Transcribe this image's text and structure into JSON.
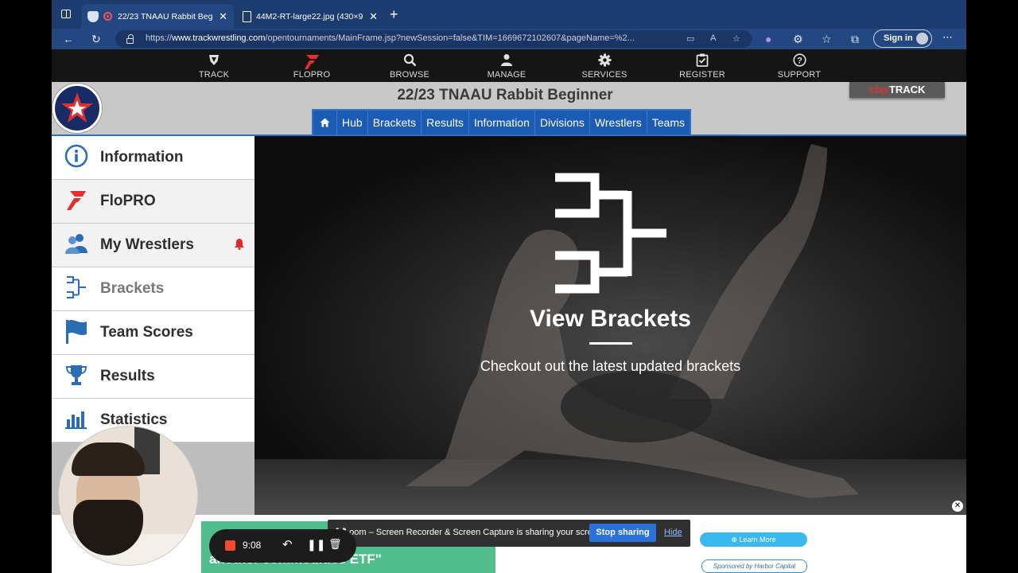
{
  "browser": {
    "tabs": [
      {
        "title": "22/23 TNAAU Rabbit Beg",
        "active": true
      },
      {
        "title": "44M2-RT-large22.jpg (430×9",
        "active": false
      }
    ],
    "url_prefix": "https://",
    "url_domain": "www.trackwrestling.com",
    "url_path": "/opentournaments/MainFrame.jsp?newSession=false&TIM=1669672102607&pageName=%2...",
    "signin_label": "Sign in"
  },
  "site_nav": {
    "items": [
      {
        "label": "TRACK",
        "icon": "track-shield-icon"
      },
      {
        "label": "FLOPRO",
        "icon": "flo-icon"
      },
      {
        "label": "BROWSE",
        "icon": "search-icon"
      },
      {
        "label": "MANAGE",
        "icon": "user-icon"
      },
      {
        "label": "SERVICES",
        "icon": "gear-icon"
      },
      {
        "label": "REGISTER",
        "icon": "clipboard-icon"
      },
      {
        "label": "SUPPORT",
        "icon": "help-icon"
      }
    ]
  },
  "event": {
    "title": "22/23 TNAAU Rabbit Beginner",
    "claytrack_a": "clay",
    "claytrack_b": "TRACK",
    "tabs": [
      "Hub",
      "Brackets",
      "Results",
      "Information",
      "Divisions",
      "Wrestlers",
      "Teams"
    ]
  },
  "sidebar": {
    "items": [
      {
        "label": "Information",
        "icon": "info-icon"
      },
      {
        "label": "FloPRO",
        "icon": "flo-icon"
      },
      {
        "label": "My Wrestlers",
        "icon": "users-icon"
      },
      {
        "label": "Brackets",
        "icon": "bracket-icon"
      },
      {
        "label": "Team Scores",
        "icon": "flag-icon"
      },
      {
        "label": "Results",
        "icon": "trophy-icon"
      },
      {
        "label": "Statistics",
        "icon": "bar-chart-icon"
      }
    ]
  },
  "hero": {
    "title": "View Brackets",
    "subtitle": "Checkout out the latest updated brackets"
  },
  "ad": {
    "text": "another commodities ETF\"",
    "learn_more": "Learn More",
    "sponsor": "Sponsored by Harbor Capital"
  },
  "loom": {
    "message": "Loom – Screen Recorder & Screen Capture is sharing your screen.",
    "stop_label": "Stop sharing",
    "hide_label": "Hide",
    "timer": "9:08"
  },
  "colors": {
    "tabstrip": "#1c3b6e",
    "event_tab_blue": "#1c5bb3",
    "sidebar_icon_blue": "#2a6db5",
    "flo_red": "#e03131",
    "loom_stop_blue": "#2a71d8"
  }
}
